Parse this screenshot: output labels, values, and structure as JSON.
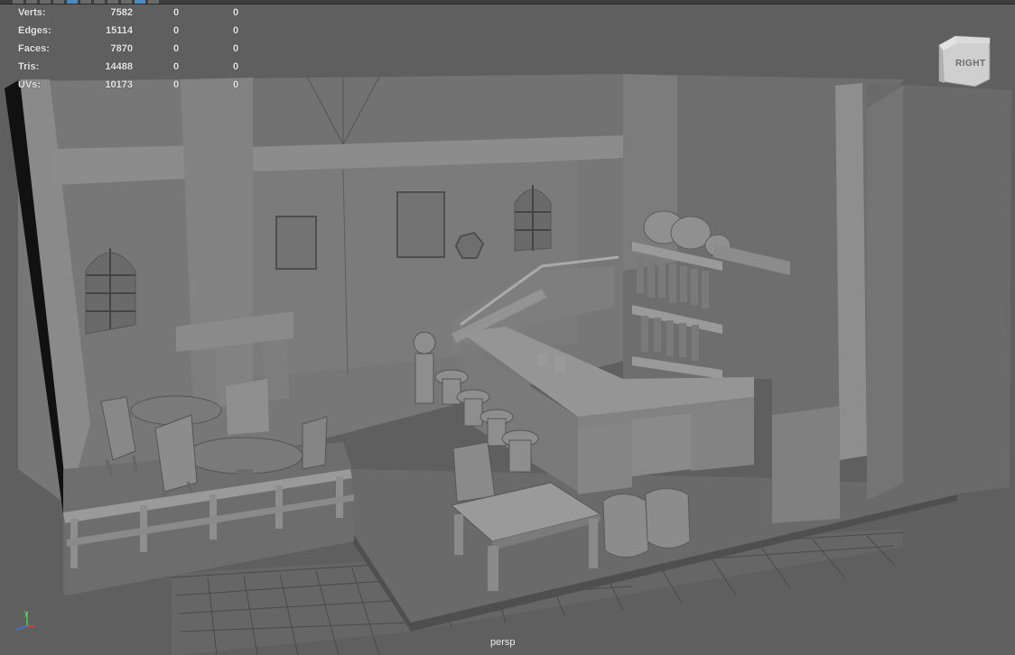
{
  "viewport": {
    "camera_label": "persp",
    "viewcube_label": "RIGHT",
    "axis_y_label": "y"
  },
  "hud": {
    "rows": [
      {
        "label": "Verts:",
        "v0": "7582",
        "v1": "0",
        "v2": "0"
      },
      {
        "label": "Edges:",
        "v0": "15114",
        "v1": "0",
        "v2": "0"
      },
      {
        "label": "Faces:",
        "v0": "7870",
        "v1": "0",
        "v2": "0"
      },
      {
        "label": "Tris:",
        "v0": "14488",
        "v1": "0",
        "v2": "0"
      },
      {
        "label": "UVs:",
        "v0": "10173",
        "v1": "0",
        "v2": "0"
      }
    ]
  },
  "colors": {
    "viewport_bg": "#5f5f5f",
    "hud_text": "#e8e8e8",
    "axis_x": "#e04040",
    "axis_y": "#40d040",
    "axis_z": "#4070e0",
    "accent": "#4e8ac0"
  }
}
